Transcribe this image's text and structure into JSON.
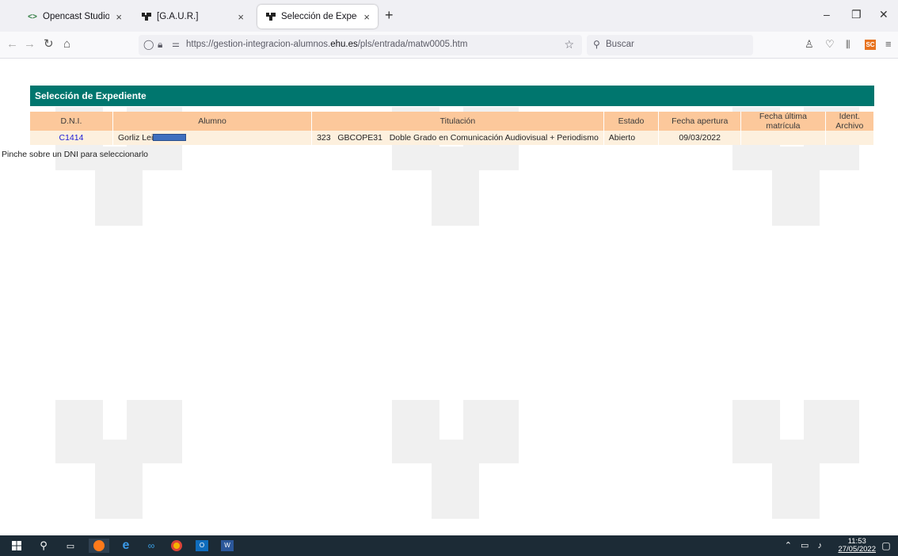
{
  "browser": {
    "tabs": [
      {
        "title": "Opencast Studio",
        "active": false
      },
      {
        "title": "[G.A.U.R.]",
        "active": false
      },
      {
        "title": "Selección de Expediente",
        "active": true
      }
    ],
    "new_tab": "+",
    "url_prefix": "https://gestion-integracion-alumnos.",
    "url_domain": "ehu.es",
    "url_suffix": "/pls/entrada/matw0005.htm",
    "search_placeholder": "Buscar"
  },
  "page": {
    "title": "Selección de Expediente",
    "columns": [
      "D.N.I.",
      "Alumno",
      "Titulación",
      "Estado",
      "Fecha apertura",
      "Fecha última matrícula",
      "Ident. Archivo"
    ],
    "rows": [
      {
        "dni": "C1414",
        "alumno": "Gorliz Leio",
        "titulacion": "323   GBCOPE31   Doble Grado en Comunicación Audiovisual + Periodismo",
        "estado": "Abierto",
        "fecha_apertura": "09/03/2022",
        "fecha_ultima_matricula": "",
        "ident_archivo": ""
      }
    ],
    "hint": "Pinche sobre un DNI para seleccionarlo"
  },
  "taskbar": {
    "time": "11:53",
    "date": "27/05/2022"
  },
  "colors": {
    "header_teal": "#00766e",
    "table_header": "#fcc89b",
    "table_row": "#fdf0de",
    "link": "#1a1ad6"
  }
}
